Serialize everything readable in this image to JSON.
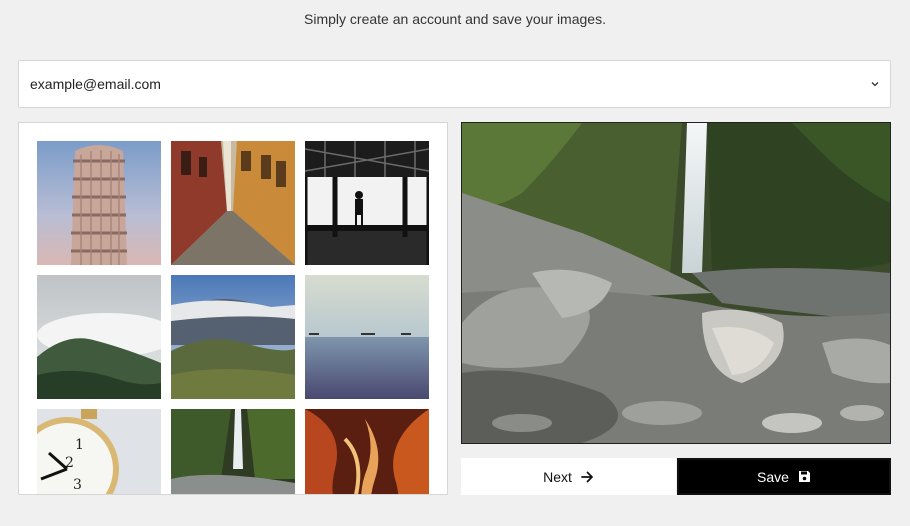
{
  "header": {
    "tagline": "Simply create an account and save your images."
  },
  "email_select": {
    "value": "example@email.com",
    "icon": "chevron-down-icon"
  },
  "gallery": {
    "images": [
      {
        "subject": "leaning tower"
      },
      {
        "subject": "narrow cobblestone street"
      },
      {
        "subject": "silhouette in station"
      },
      {
        "subject": "misty mountain"
      },
      {
        "subject": "cloudy valley"
      },
      {
        "subject": "calm sea with ships"
      },
      {
        "subject": "pocket watch"
      },
      {
        "subject": "waterfall"
      },
      {
        "subject": "slot canyon"
      }
    ]
  },
  "preview": {
    "subject": "waterfall over rocky stream"
  },
  "actions": {
    "next_label": "Next",
    "next_icon": "arrow-right-icon",
    "save_label": "Save",
    "save_icon": "floppy-disk-icon"
  },
  "colors": {
    "background": "#f0f0f0",
    "save_button": "#000000",
    "next_button": "#ffffff"
  }
}
